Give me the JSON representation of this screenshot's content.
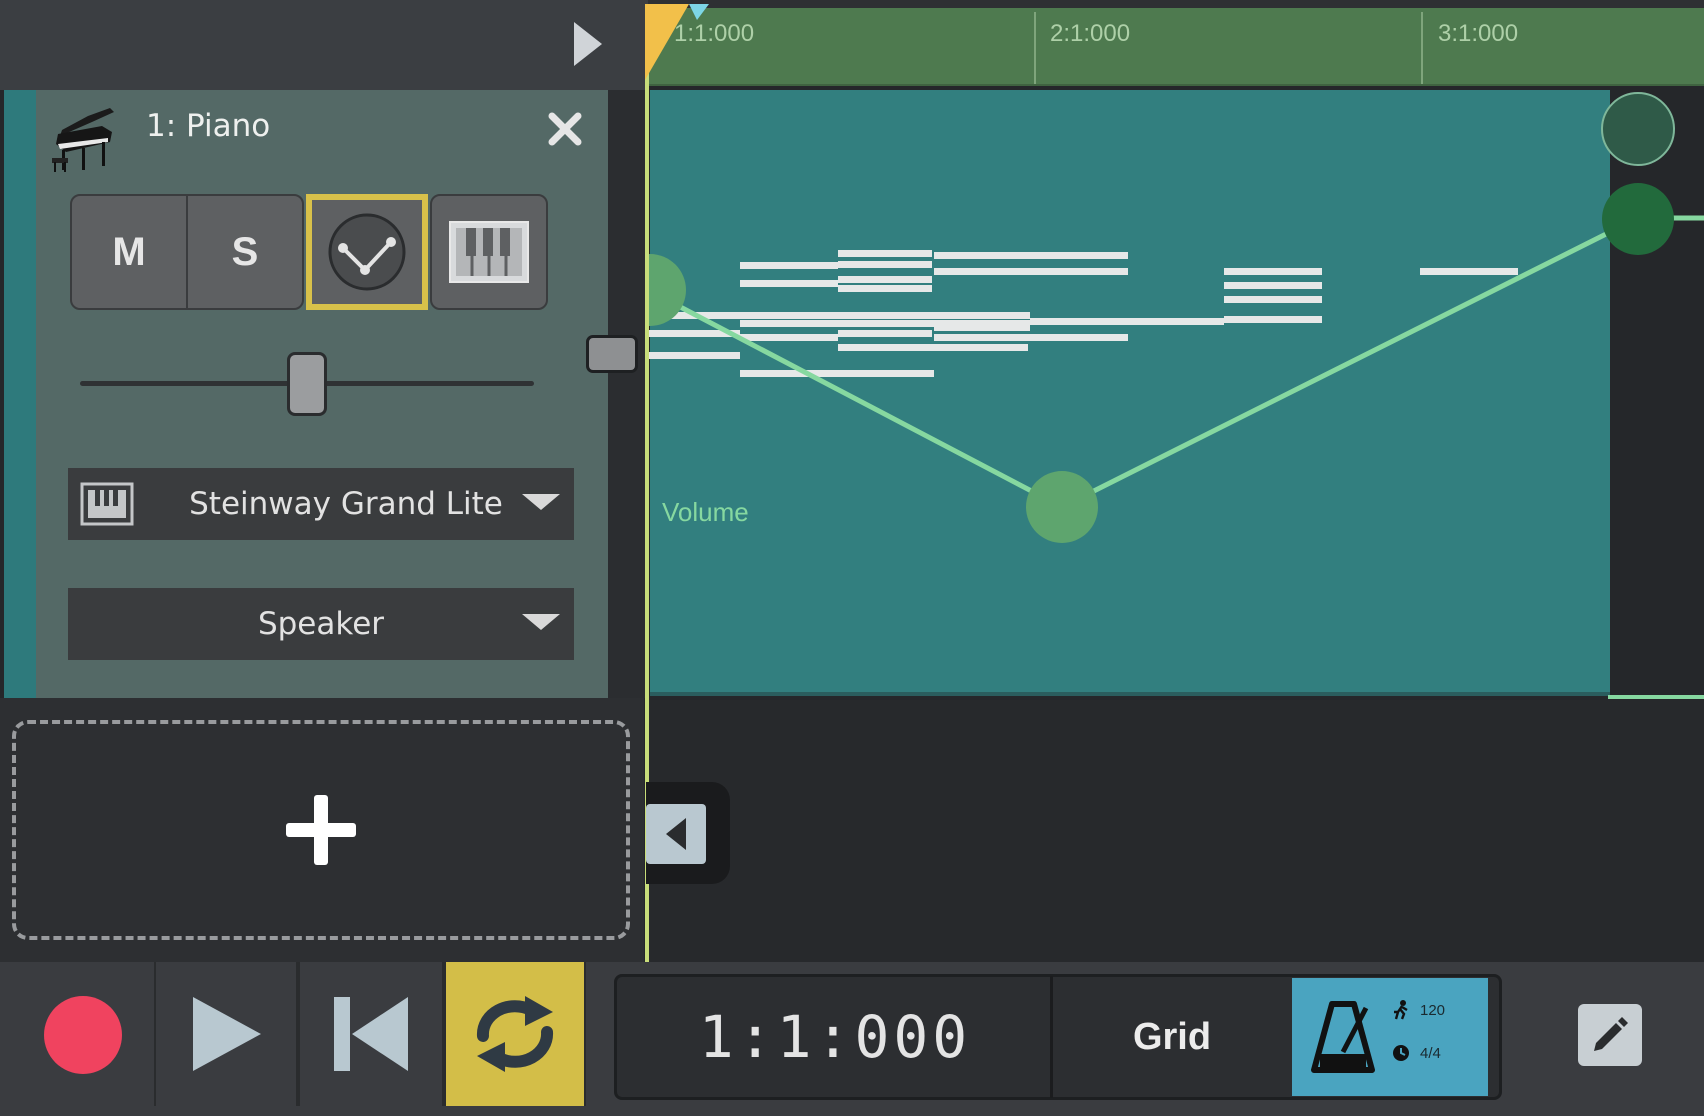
{
  "ruler": {
    "labels": [
      "1:1:000",
      "2:1:000",
      "3:1:000"
    ]
  },
  "track": {
    "name": "1: Piano",
    "mute_label": "M",
    "solo_label": "S",
    "volume_fraction": 0.5,
    "instrument": "Steinway Grand Lite",
    "output": "Speaker",
    "color": "#2e7a7c"
  },
  "clip": {
    "automation_label": "Volume",
    "color": "#327f7f",
    "automation_color": "#86d8a0"
  },
  "transport": {
    "position": "1:1:000",
    "grid_label": "Grid",
    "tempo": "120",
    "time_signature": "4/4",
    "record_color": "#f0435f",
    "loop_color": "#d3be48",
    "metronome_color": "#4aa4c0"
  }
}
